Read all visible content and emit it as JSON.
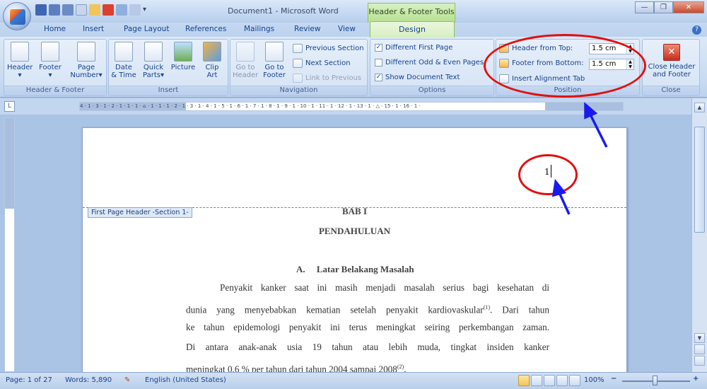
{
  "window": {
    "title": "Document1 - Microsoft Word",
    "contextual_title": "Header & Footer Tools"
  },
  "tabs": [
    "Home",
    "Insert",
    "Page Layout",
    "References",
    "Mailings",
    "Review",
    "View"
  ],
  "active_tab": "Design",
  "ribbon": {
    "header_footer": {
      "label": "Header & Footer",
      "header": "Header",
      "footer": "Footer",
      "page_number_1": "Page",
      "page_number_2": "Number",
      "dropdown_arrow": "▾"
    },
    "insert": {
      "label": "Insert",
      "date_time_1": "Date",
      "date_time_2": "& Time",
      "quick_parts_1": "Quick",
      "quick_parts_2": "Parts",
      "picture": "Picture",
      "clip_art_1": "Clip",
      "clip_art_2": "Art",
      "dropdown_arrow": "▾"
    },
    "navigation": {
      "label": "Navigation",
      "go_to_header_1": "Go to",
      "go_to_header_2": "Header",
      "go_to_footer_1": "Go to",
      "go_to_footer_2": "Footer",
      "previous_section": "Previous Section",
      "next_section": "Next Section",
      "link_to_previous": "Link to Previous"
    },
    "options": {
      "label": "Options",
      "different_first_page": "Different First Page",
      "different_odd_even": "Different Odd & Even Pages",
      "show_document_text": "Show Document Text",
      "check_mark": "✓"
    },
    "position": {
      "label": "Position",
      "header_from_top": "Header from Top:",
      "header_from_top_value": "1.5 cm",
      "footer_from_bottom": "Footer from Bottom:",
      "footer_from_bottom_value": "1.5 cm",
      "insert_alignment_tab": "Insert Alignment Tab",
      "spin_up": "▲",
      "spin_down": "▼"
    },
    "close": {
      "label": "Close",
      "close_1": "Close Header",
      "close_2": "and Footer",
      "close_glyph": "✕"
    }
  },
  "ruler_text": "4 · 1 · 3 · 1 · 2 · 1 · 1 · 1 · ⌂ · 1 · 1 · 1 · 2 · 1 · 3 · 1 · 4 · 1 · 5 · 1 · 6 · 1 · 7 · 1 · 8 · 1 · 9 · 1 · 10 · 1 · 11 · 1 · 12 · 1 · 13 · 1 · △ · 15 · 1 · 16 · 1 ·",
  "document": {
    "header_tag": "First Page Header -Section 1-",
    "page_number": "1",
    "title_1": "BAB I",
    "title_2": "PENDAHULUAN",
    "subheading": "A.     Latar Belakang Masalah",
    "lines": [
      "Penyakit kanker saat ini masih menjadi masalah serius bagi kesehatan di",
      "dunia yang menyebabkan kematian setelah penyakit kardiovaskular",
      "ke tahun epidemologi penyakit ini terus meningkat seiring perkembangan zaman.",
      "Di antara anak-anak usia 19 tahun atau lebih muda, tingkat insiden kanker",
      "meningkat 0,6 % per tahun dari tahun 2004 sampai 2008"
    ],
    "line2_sup": "(1)",
    "line2_tail": ". Dari tahun",
    "line5_sup": "(2)",
    "line5_tail": "."
  },
  "statusbar": {
    "page": "Page: 1 of 27",
    "words": "Words: 5,890",
    "language": "English (United States)",
    "zoom": "100%",
    "zoom_minus": "−",
    "zoom_plus": "+"
  },
  "ui_glyphs": {
    "minimize": "—",
    "restore": "❐",
    "close": "✕",
    "help": "?",
    "scroll_up": "▲",
    "scroll_down": "▼",
    "ruler_tab": "L",
    "qat_more": "▾"
  },
  "colors": {
    "annotation_red": "#e01010",
    "annotation_blue": "#1a1aee",
    "contextual_green": "#b6e08f"
  }
}
